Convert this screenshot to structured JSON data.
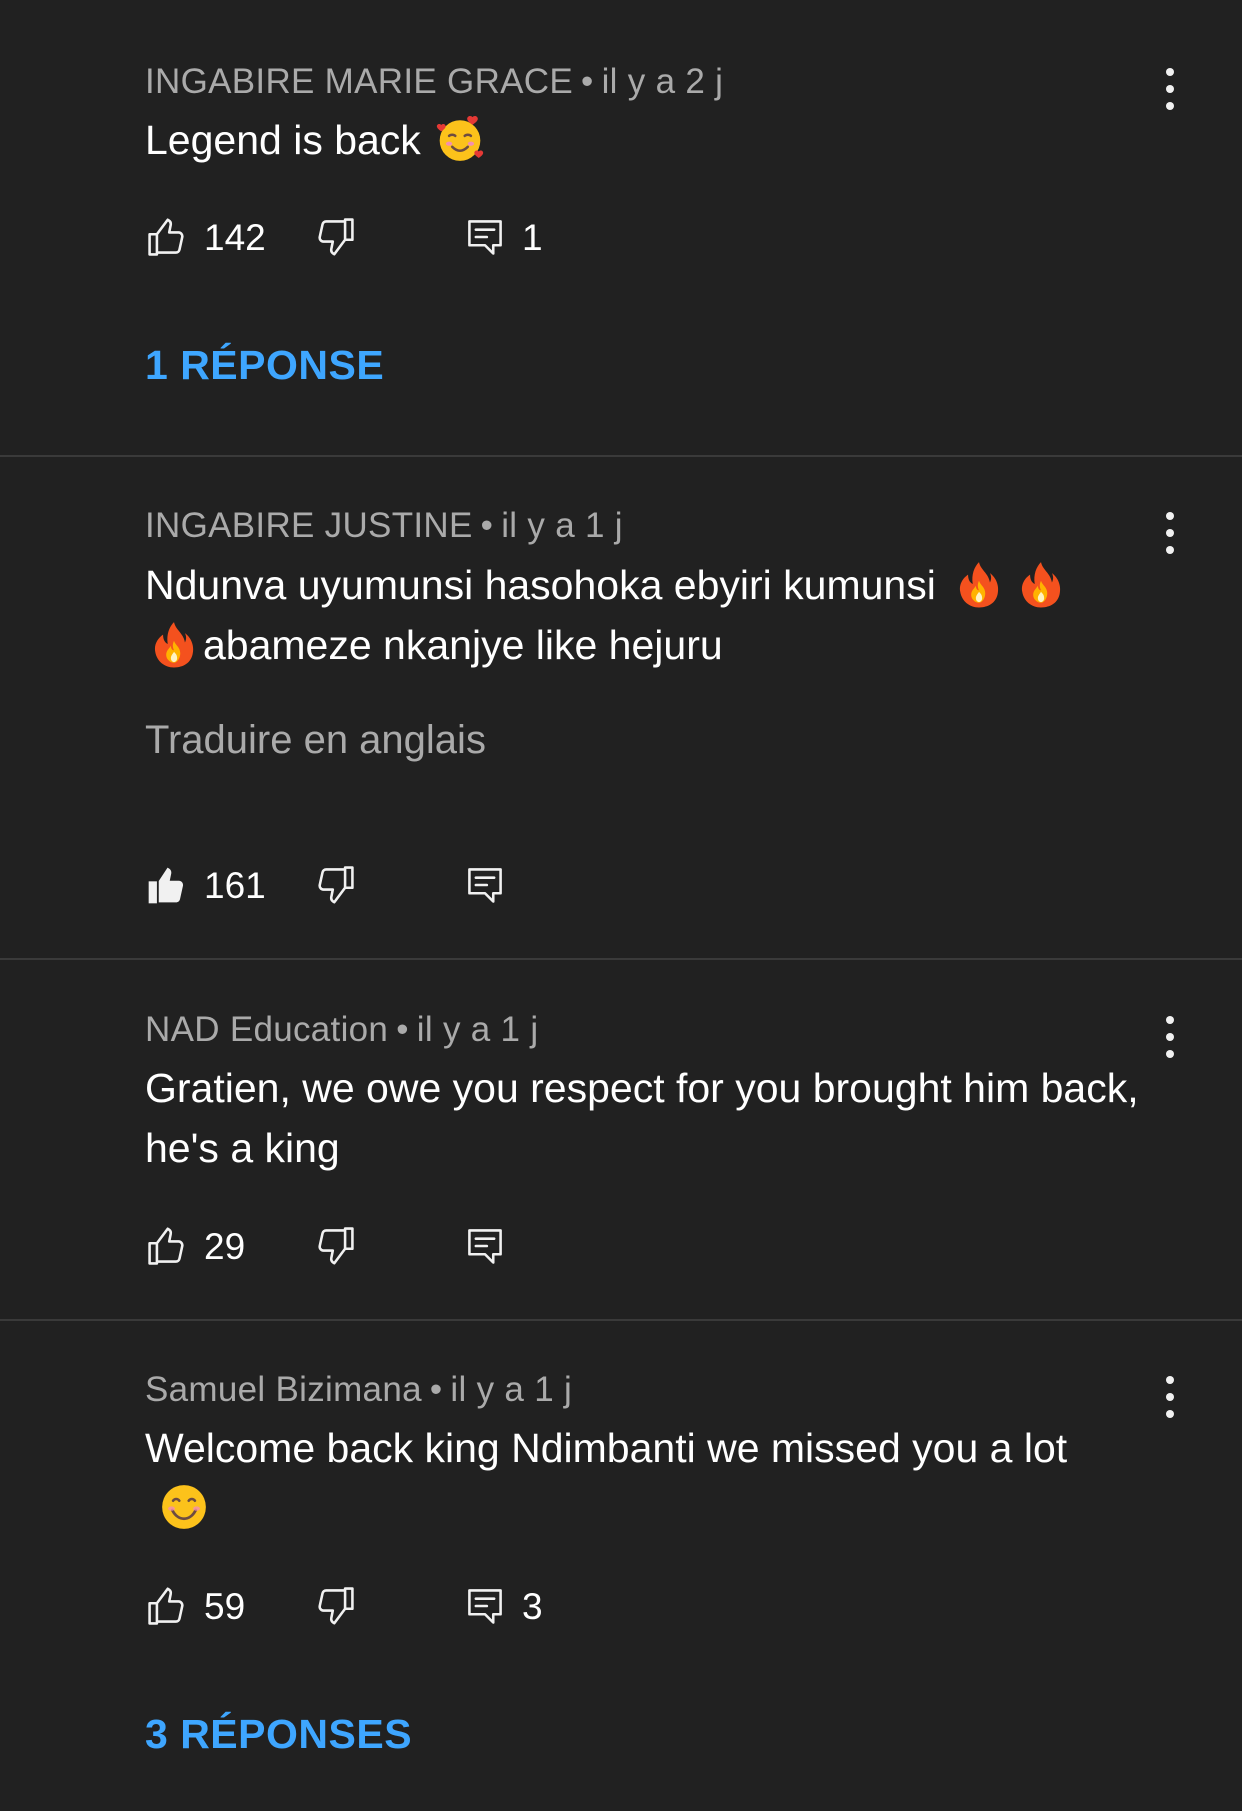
{
  "comments": [
    {
      "author": "INGABIRE MARIE GRACE",
      "time": "il y a 2 j",
      "text": "Legend is back",
      "emoji": "smiling-face-with-hearts",
      "likes": "142",
      "liked": false,
      "reply_count": "1",
      "replies_label": "1 RÉPONSE"
    },
    {
      "author": "INGABIRE JUSTINE",
      "time": "il y a 1 j",
      "text_part1": "Ndunva uyumunsi hasohoka ebyiri kumunsi",
      "text_part2": "abameze nkanjye like hejuru",
      "emoji": "fire",
      "translate_label": "Traduire en anglais",
      "likes": "161",
      "liked": true
    },
    {
      "author": "NAD Education",
      "time": "il y a 1 j",
      "text": "Gratien, we owe you respect for you brought him back, he's a king",
      "likes": "29",
      "liked": false
    },
    {
      "author": "Samuel Bizimana",
      "time": "il y a 1 j",
      "text": "Welcome back king Ndimbanti we missed you a lot",
      "emoji": "smiling-face",
      "likes": "59",
      "liked": false,
      "reply_count": "3",
      "replies_label": "3 RÉPONSES"
    }
  ],
  "meta_separator": "•",
  "colors": {
    "background": "#212121",
    "text": "#ffffff",
    "secondary_text": "#aaaaaa",
    "link": "#3ea6ff",
    "divider": "#3a3a3a"
  }
}
